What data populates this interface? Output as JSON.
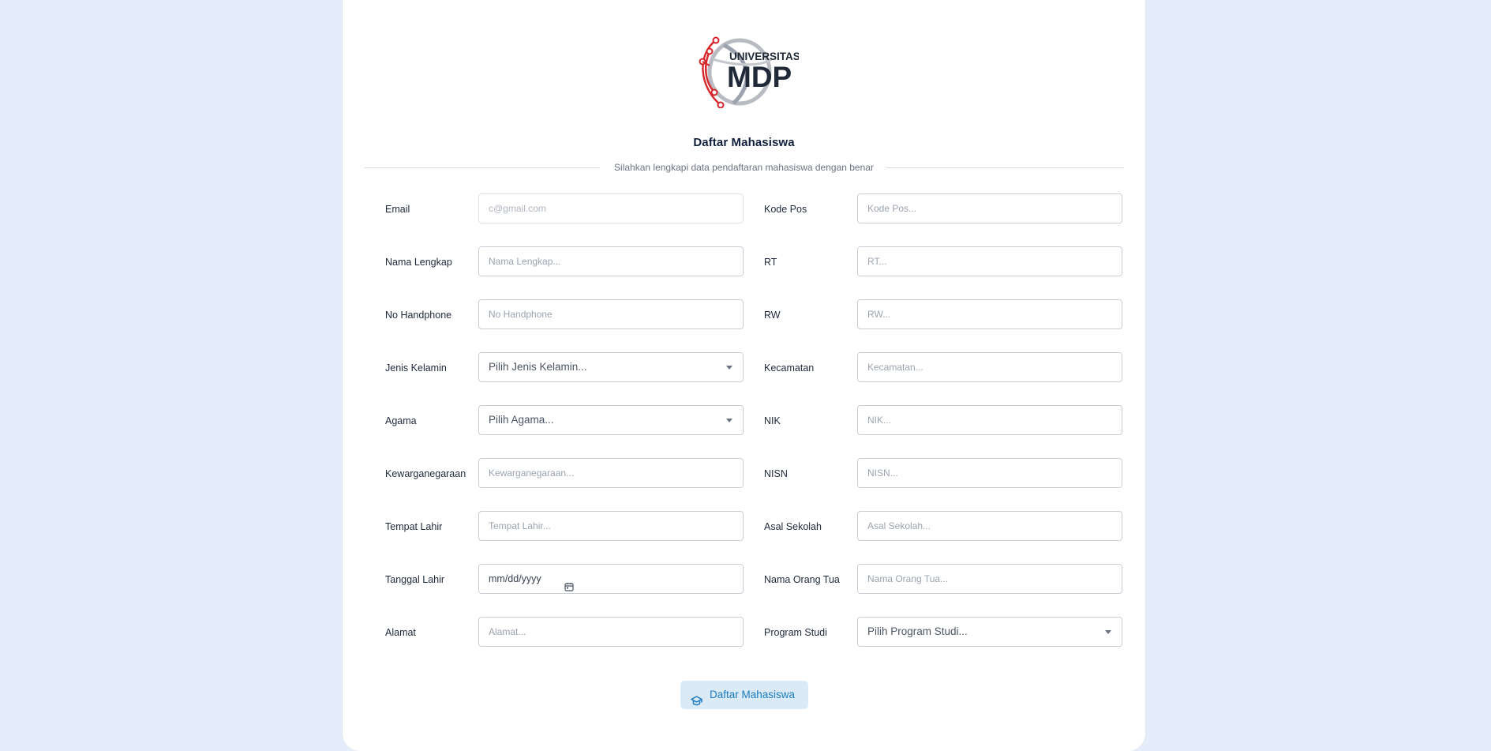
{
  "logo": {
    "line1": "UNIVERSITAS",
    "line2": "MDP",
    "accent_color": "#d7262a",
    "globe_color": "#9ca3af"
  },
  "form": {
    "title": "Daftar Mahasiswa",
    "subtitle": "Silahkan lengkapi data pendaftaran mahasiswa dengan benar",
    "left_fields": [
      {
        "label": "Email",
        "placeholder": "c@gmail.com",
        "type": "text",
        "state": "disabled"
      },
      {
        "label": "Nama Lengkap",
        "placeholder": "Nama Lengkap...",
        "type": "text"
      },
      {
        "label": "No Handphone",
        "placeholder": "No Handphone",
        "type": "text"
      },
      {
        "label": "Jenis Kelamin",
        "value": "Pilih Jenis Kelamin...",
        "type": "select"
      },
      {
        "label": "Agama",
        "value": "Pilih Agama...",
        "type": "select"
      },
      {
        "label": "Kewarganegaraan",
        "placeholder": "Kewarganegaraan...",
        "type": "text"
      },
      {
        "label": "Tempat Lahir",
        "placeholder": "Tempat Lahir...",
        "type": "text"
      },
      {
        "label": "Tanggal Lahir",
        "value": "mm/dd/yyyy",
        "type": "date",
        "icon": "calendar-icon"
      },
      {
        "label": "Alamat",
        "placeholder": "Alamat...",
        "type": "text"
      }
    ],
    "right_fields": [
      {
        "label": "Kode Pos",
        "placeholder": "Kode Pos...",
        "type": "text"
      },
      {
        "label": "RT",
        "placeholder": "RT...",
        "type": "text"
      },
      {
        "label": "RW",
        "placeholder": "RW...",
        "type": "text"
      },
      {
        "label": "Kecamatan",
        "placeholder": "Kecamatan...",
        "type": "text"
      },
      {
        "label": "NIK",
        "placeholder": "NIK...",
        "type": "text"
      },
      {
        "label": "NISN",
        "placeholder": "NISN...",
        "type": "text"
      },
      {
        "label": "Asal Sekolah",
        "placeholder": "Asal Sekolah...",
        "type": "text"
      },
      {
        "label": "Nama Orang Tua",
        "placeholder": "Nama Orang Tua...",
        "type": "text"
      },
      {
        "label": "Program Studi",
        "value": "Pilih Program Studi...",
        "type": "select"
      }
    ],
    "submit": {
      "label": "Daftar Mahasiswa",
      "icon": "graduation-cap-icon",
      "color": "#1b7cc0",
      "background": "#dbeaf7"
    }
  }
}
